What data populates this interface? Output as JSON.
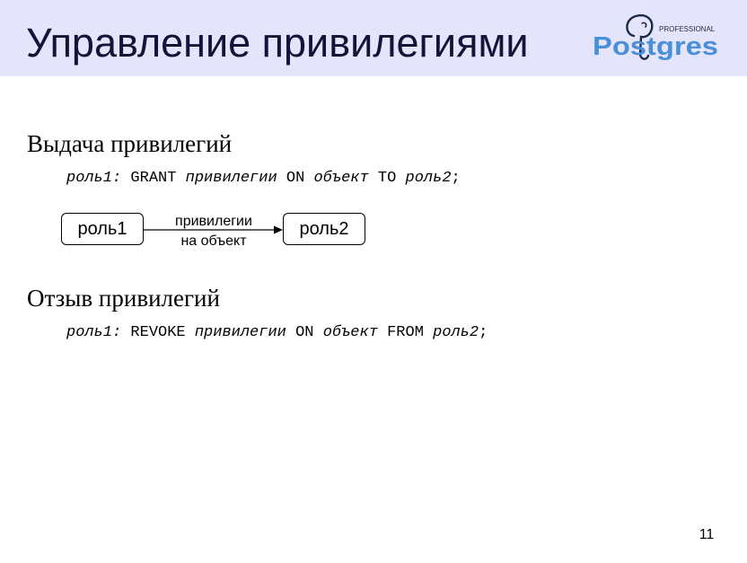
{
  "slide": {
    "title": "Управление привилегиями",
    "page_number": "11"
  },
  "logo": {
    "brand": "Postgres",
    "tagline": "PROFESSIONAL",
    "icon": "elephant-icon",
    "colors": {
      "brand_blue": "#4a90d9",
      "navy": "#1c2a4a"
    }
  },
  "grant": {
    "heading": "Выдача привилегий",
    "code": {
      "role1": "роль1:",
      "kw_grant": "GRANT",
      "privileges": "привилегии",
      "kw_on": "ON",
      "object": "объект",
      "kw_to": "TO",
      "role2": "роль2",
      "terminator": ";"
    },
    "diagram": {
      "from_role": "роль1",
      "to_role": "роль2",
      "arrow_label_line1": "привилегии",
      "arrow_label_line2": "на объект"
    }
  },
  "revoke": {
    "heading": "Отзыв привилегий",
    "code": {
      "role1": "роль1:",
      "kw_revoke": "REVOKE",
      "privileges": "привилегии",
      "kw_on": "ON",
      "object": "объект",
      "kw_from": "FROM",
      "role2": "роль2",
      "terminator": ";"
    }
  },
  "colors": {
    "header_bg": "#e4e4fa",
    "title_text": "#14143a"
  }
}
